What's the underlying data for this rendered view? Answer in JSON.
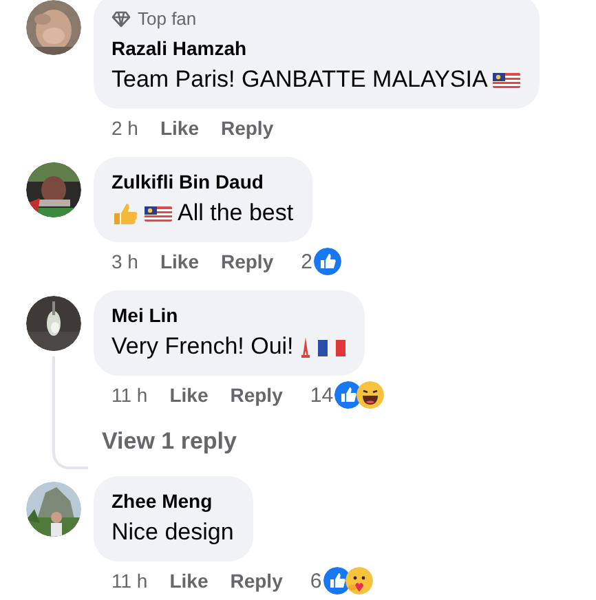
{
  "comments": [
    {
      "author": "Razali Hamzah",
      "badge": "Top fan",
      "text": "Team Paris! GANBATTE MALAYSIA",
      "emojis_after": [
        {
          "kind": "malaysia-flag"
        }
      ],
      "time": "2 h",
      "actions": [
        "Like",
        "Reply"
      ]
    },
    {
      "author": "Zulkifli Bin Daud",
      "text": "All the best",
      "emojis_before": [
        {
          "kind": "thumbs-up"
        },
        {
          "kind": "malaysia-flag"
        }
      ],
      "time": "3 h",
      "actions": [
        "Like",
        "Reply"
      ],
      "reactions": {
        "count": "2",
        "kinds": [
          {
            "kind": "like"
          }
        ]
      }
    },
    {
      "author": "Mei Lin",
      "text": "Very French! Oui!",
      "emojis_after": [
        {
          "kind": "tower"
        },
        {
          "kind": "france-flag"
        }
      ],
      "time": "11 h",
      "actions": [
        "Like",
        "Reply"
      ],
      "reactions": {
        "count": "14",
        "kinds": [
          {
            "kind": "like"
          },
          {
            "kind": "haha"
          }
        ]
      },
      "replies_link": "View 1 reply"
    },
    {
      "author": "Zhee Meng",
      "text": "Nice design",
      "time": "11 h",
      "actions": [
        "Like",
        "Reply"
      ],
      "reactions": {
        "count": "6",
        "kinds": [
          {
            "kind": "like"
          },
          {
            "kind": "care"
          }
        ]
      }
    }
  ]
}
